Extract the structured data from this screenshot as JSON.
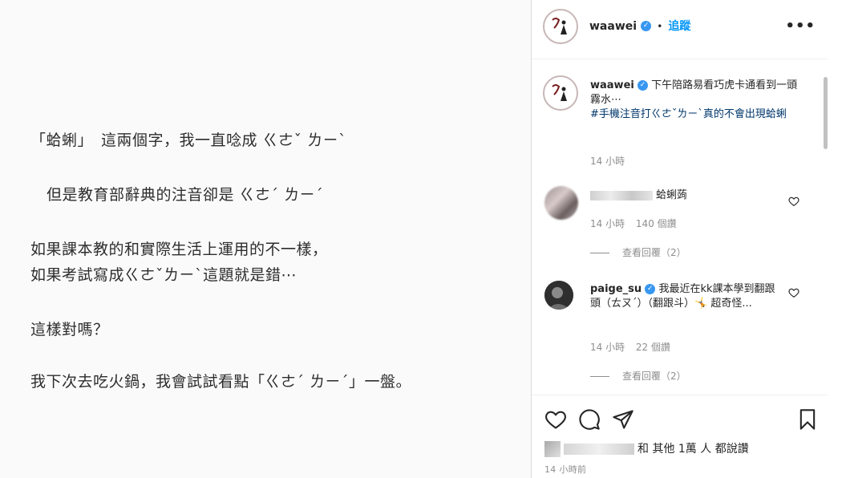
{
  "post_image": {
    "lines": [
      "「蛤蜊」　這兩個字，我一直唸成 ㄍㄜˇ ㄌㄧˋ",
      "但是教育部辭典的注音卻是 ㄍㄜˊ ㄌㄧˊ",
      "如果課本教的和實際生活上運用的不一樣，",
      "如果考試寫成ㄍㄜˇㄌㄧˋ這題就是錯⋯",
      "這樣對嗎？",
      "我下次去吃火鍋，我會試試看點「ㄍㄜˊ ㄌㄧˊ」一盤。"
    ]
  },
  "header": {
    "username": "waawei",
    "separator": "•",
    "follow_label": "追蹤",
    "more_label": "•••"
  },
  "caption": {
    "username": "waawei",
    "text": "下午陪路易看巧虎卡通看到一頭霧水⋯",
    "hashtag": "#手機注音打ㄍㄜˇㄌㄧˋ真的不會出現蛤蜊",
    "time": "14 小時"
  },
  "comments": [
    {
      "text": "蛤蜊蒟",
      "time": "14 小時",
      "likes": "140 個讚",
      "view_replies": "查看回覆（2）"
    },
    {
      "username": "paige_su",
      "text": "我最近在kk課本學到翻跟頭（ㄊㄡˊ）（翻跟斗）🤸 超奇怪...",
      "time": "14 小時",
      "likes": "22 個讚",
      "view_replies": "查看回覆（2）"
    }
  ],
  "footer": {
    "likes_text": "和 其他 1萬 人 都說讚",
    "time_ago": "14 小時前"
  },
  "colors": {
    "link_blue": "#0095f6",
    "verified_blue": "#3897f0",
    "hashtag": "#00376b",
    "muted": "#8e8e8e"
  }
}
